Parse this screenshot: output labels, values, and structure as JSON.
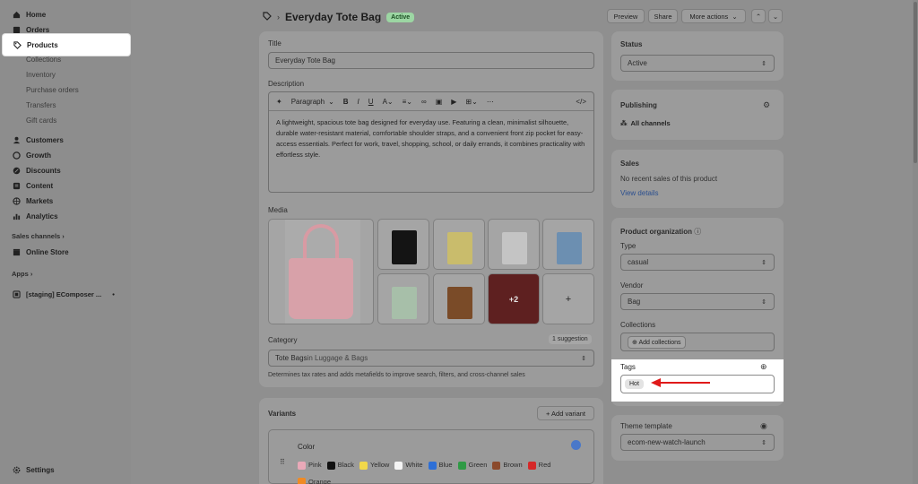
{
  "sidebar": {
    "home": "Home",
    "orders": "Orders",
    "products": "Products",
    "collections": "Collections",
    "inventory": "Inventory",
    "purchase_orders": "Purchase orders",
    "transfers": "Transfers",
    "gift_cards": "Gift cards",
    "customers": "Customers",
    "growth": "Growth",
    "discounts": "Discounts",
    "content": "Content",
    "markets": "Markets",
    "analytics": "Analytics",
    "sales_channels": "Sales channels",
    "online_store": "Online Store",
    "apps": "Apps",
    "staging_app": "[staging] EComposer ...",
    "settings": "Settings"
  },
  "header": {
    "title": "Everyday Tote Bag",
    "status_badge": "Active",
    "preview": "Preview",
    "share": "Share",
    "more_actions": "More actions"
  },
  "title_card": {
    "label": "Title",
    "value": "Everyday Tote Bag",
    "description_label": "Description",
    "paragraph_select": "Paragraph",
    "description_text": "A lightweight, spacious tote bag designed for everyday use. Featuring a clean, minimalist silhouette, durable water-resistant material, comfortable shoulder straps, and a convenient front zip pocket for easy-access essentials. Perfect for work, travel, shopping, school, or daily errands, it combines practicality with effortless style.",
    "media_label": "Media",
    "more_media": "+2",
    "add_media": "+",
    "category_label": "Category",
    "suggestion": "1 suggestion",
    "category_value": "Tote Bags",
    "category_suffix": " in Luggage & Bags",
    "category_help": "Determines tax rates and adds metafields to improve search, filters, and cross-channel sales"
  },
  "variants": {
    "label": "Variants",
    "add_variant": "+ Add variant",
    "option_name": "Color",
    "colors": [
      {
        "name": "Pink",
        "hex": "#e9a9b8"
      },
      {
        "name": "Black",
        "hex": "#111111"
      },
      {
        "name": "Yellow",
        "hex": "#f2d84a"
      },
      {
        "name": "White",
        "hex": "#f4f4f4"
      },
      {
        "name": "Blue",
        "hex": "#2d6fd6"
      },
      {
        "name": "Green",
        "hex": "#2f9a45"
      },
      {
        "name": "Brown",
        "hex": "#8b4a2c"
      },
      {
        "name": "Red",
        "hex": "#d52828"
      },
      {
        "name": "Orange",
        "hex": "#f08a24"
      }
    ]
  },
  "status_card": {
    "label": "Status",
    "value": "Active"
  },
  "publishing_card": {
    "label": "Publishing",
    "channels": "All channels"
  },
  "sales_card": {
    "label": "Sales",
    "text": "No recent sales of this product",
    "link": "View details"
  },
  "organization": {
    "label": "Product organization",
    "type_label": "Type",
    "type_value": "casual",
    "vendor_label": "Vendor",
    "vendor_value": "Bag",
    "collections_label": "Collections",
    "add_collections": "Add collections",
    "tags_label": "Tags",
    "tag": "Hot"
  },
  "theme_card": {
    "label": "Theme template",
    "value": "ecom-new-watch-launch"
  },
  "colors": {
    "highlight": "#ffffff",
    "annotation_arrow": "#e01a1a",
    "active_badge": "#9cd6a3"
  }
}
